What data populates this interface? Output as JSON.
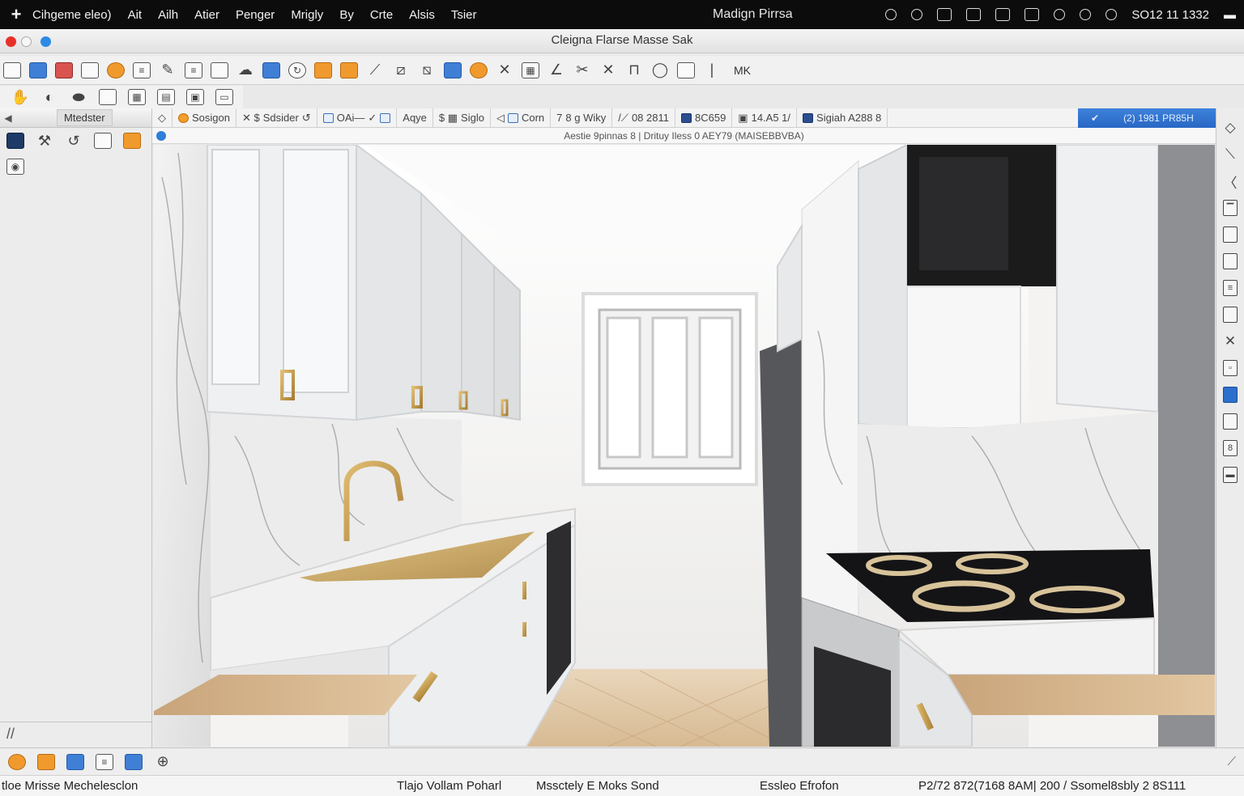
{
  "menubar": {
    "app_name": "Cihgeme eleo)",
    "items": [
      "Ait",
      "Ailh",
      "Atier",
      "Penger",
      "Mrigly",
      "By",
      "Crte",
      "Alsis",
      "Tsier"
    ],
    "center_title": "Madign Pirrsa",
    "clock": "SO12 11 1332",
    "tray_icons": [
      "location-icon",
      "wifi-icon",
      "window-icon",
      "camera-icon",
      "battery-icon",
      "screen-icon",
      "pin-icon",
      "search-icon",
      "user-icon"
    ]
  },
  "window": {
    "title": "Cleigna Flarse Masse Sak",
    "traffic_colors": {
      "close": "#e8302a",
      "minimize": "#f1f1f1",
      "zoom": "#2e8ae6"
    }
  },
  "toolbar": {
    "label_mk": "MK"
  },
  "sidebar": {
    "title": "Mtedster",
    "footer_glyph": "//"
  },
  "options_bar": {
    "items": [
      {
        "label": "Sosigon",
        "icon": "orange-circle-icon"
      },
      {
        "label": "Sdsider",
        "icon": "dollar-icon"
      },
      {
        "label": "OAi—",
        "icon": "blue-box-icon"
      },
      {
        "label": "Aqye",
        "icon": "blue-box-icon"
      },
      {
        "label": "Siglo",
        "icon": "grid-icon"
      },
      {
        "label": "Corn",
        "icon": "blue-bar-icon"
      },
      {
        "label": "8 g Wiky",
        "icon": "line-icon"
      },
      {
        "label": "08 2811",
        "icon": "slash-icon"
      },
      {
        "label": "8C659",
        "icon": "blue-flag-icon"
      },
      {
        "label": "14.A5 1/",
        "icon": "window-icon"
      },
      {
        "label": "Sigiah A288 8",
        "icon": "dark-flag-icon"
      }
    ],
    "active_label": "(2) 1981 PR85H"
  },
  "status_line": "Aestie 9pinnas 8 | Drituy Iless 0 AEY79 (MAISEBBVBA)",
  "colors": {
    "accent": "#2d6fcc",
    "menubar_bg": "#0c0c0c",
    "counter_wood": "#d2b48a",
    "cabinet": "#eceef0",
    "brass": "#c9a050"
  },
  "footer": {
    "left": "tloe Mrisse Mechelesclon",
    "center_1": "Tlajo Vollam Poharl",
    "center_2": "Mssctely E Moks Sond",
    "center_3": "Essleo Efrofon",
    "right": "P2/72 872(7168 8AM| 200 /  Ssomel8sbly  2  8S111"
  }
}
